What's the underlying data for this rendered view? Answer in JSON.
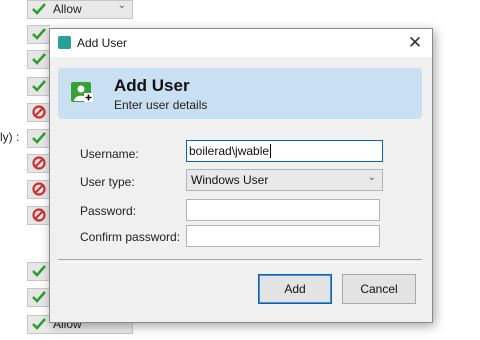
{
  "background": {
    "permission_value": "Allow",
    "side_label": "ly) :",
    "rows": [
      "allow-full",
      "allow",
      "allow",
      "allow",
      "deny",
      "allow",
      "deny",
      "deny",
      "deny",
      "allow",
      "allow",
      "allow-full"
    ]
  },
  "dialog": {
    "window_title": "Add User",
    "header_title": "Add User",
    "header_subtitle": "Enter user details",
    "fields": {
      "username_label": "Username:",
      "username_value": "boilerad\\jwable",
      "user_type_label": "User type:",
      "user_type_value": "Windows User",
      "password_label": "Password:",
      "password_value": "",
      "confirm_password_label": "Confirm password:",
      "confirm_password_value": ""
    },
    "buttons": {
      "add": "Add",
      "cancel": "Cancel"
    }
  },
  "colors": {
    "header_bg": "#c9dff2",
    "focus_border": "#0a64b4",
    "allow_green": "#2f9e2f",
    "deny_red": "#d03030"
  }
}
